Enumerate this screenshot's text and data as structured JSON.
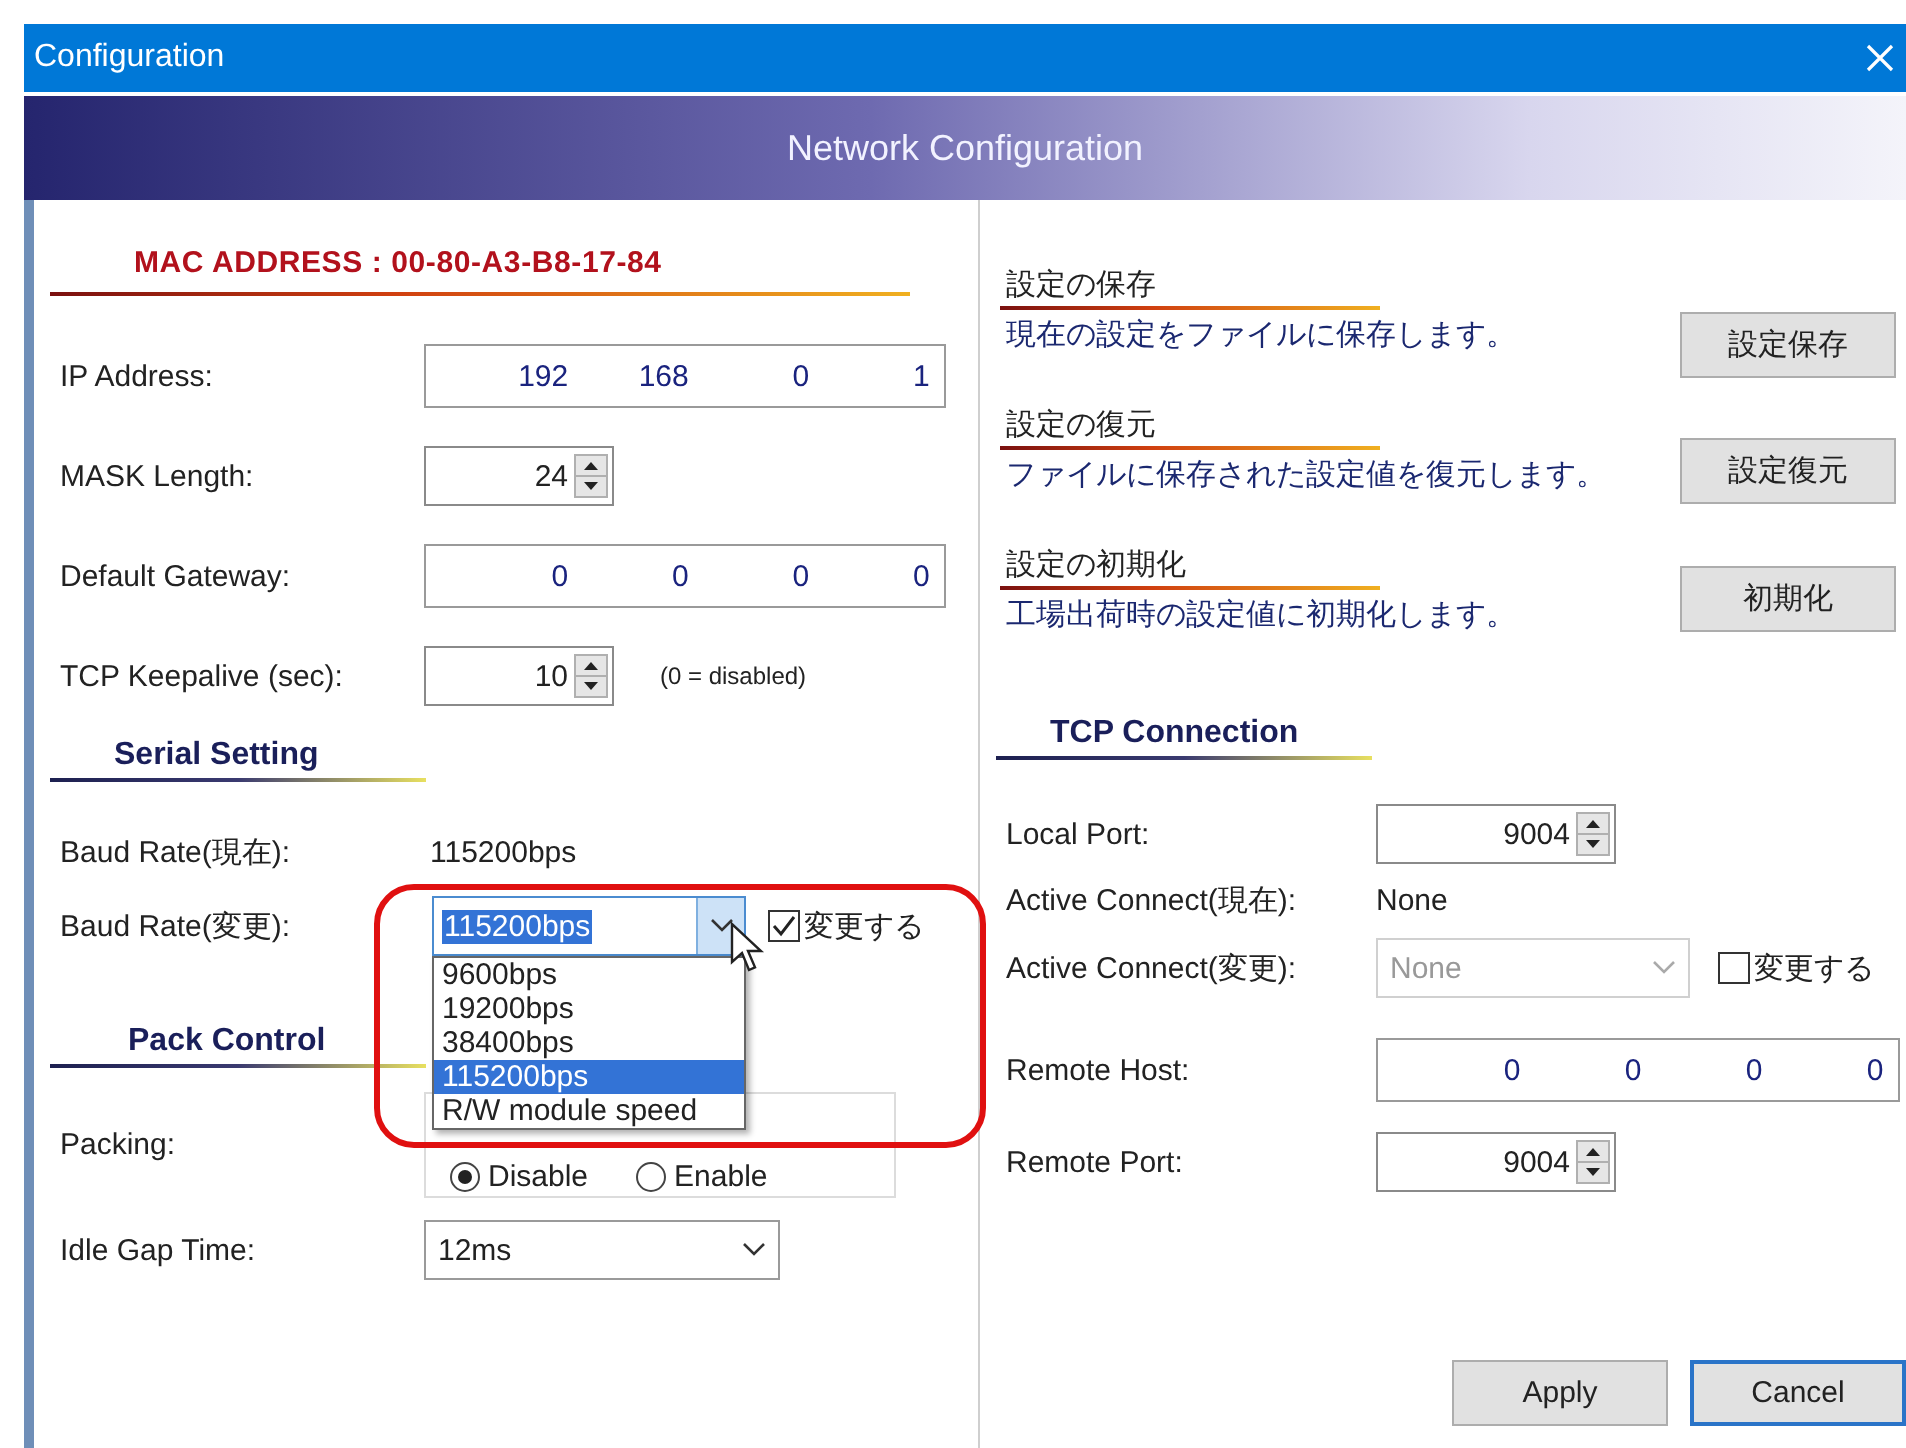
{
  "window": {
    "title": "Configuration"
  },
  "header": {
    "title": "Network Configuration"
  },
  "left": {
    "mac_heading": "MAC ADDRESS : 00-80-A3-B8-17-84",
    "network_fields": [
      {
        "label": "IP Address:",
        "kind": "ip",
        "octets": [
          "192",
          "168",
          "0",
          "1"
        ]
      },
      {
        "label": "MASK Length:",
        "kind": "spin",
        "value": "24"
      },
      {
        "label": "Default Gateway:",
        "kind": "ip",
        "octets": [
          "0",
          "0",
          "0",
          "0"
        ]
      },
      {
        "label": "TCP Keepalive (sec):",
        "kind": "spin",
        "value": "10",
        "note": "(0 = disabled)"
      }
    ],
    "serial": {
      "heading": "Serial Setting",
      "current_label": "Baud Rate(現在):",
      "current_value": "115200bps",
      "change_label": "Baud Rate(変更):",
      "change_value": "115200bps",
      "change_checkbox": {
        "label": "変更する",
        "checked": true
      },
      "dropdown": {
        "options": [
          {
            "label": "9600bps",
            "selected": false
          },
          {
            "label": "19200bps",
            "selected": false
          },
          {
            "label": "38400bps",
            "selected": false
          },
          {
            "label": "115200bps",
            "selected": true
          },
          {
            "label": "R/W module speed",
            "selected": false
          }
        ]
      }
    },
    "pack": {
      "heading": "Pack Control",
      "packing_label": "Packing:",
      "packing_options": [
        {
          "label": "Disable",
          "selected": true
        },
        {
          "label": "Enable",
          "selected": false
        }
      ],
      "idle_label": "Idle Gap Time:",
      "idle_value": "12ms"
    }
  },
  "right": {
    "file_actions": [
      {
        "heading": "設定の保存",
        "description": "現在の設定をファイルに保存します。",
        "button": "設定保存"
      },
      {
        "heading": "設定の復元",
        "description": "ファイルに保存された設定値を復元します。",
        "button": "設定復元"
      },
      {
        "heading": "設定の初期化",
        "description": "工場出荷時の設定値に初期化します。",
        "button": "初期化"
      }
    ],
    "tcp": {
      "heading": "TCP Connection",
      "fields": [
        {
          "label": "Local Port:",
          "kind": "spin",
          "value": "9004"
        },
        {
          "label": "Active Connect(現在):",
          "kind": "text",
          "value": "None"
        },
        {
          "label": "Active Connect(変更):",
          "kind": "combo",
          "value": "None",
          "disabled": true,
          "checkbox": {
            "label": "変更する",
            "checked": false
          }
        },
        {
          "label": "Remote Host:",
          "kind": "ip",
          "octets": [
            "0",
            "0",
            "0",
            "0"
          ]
        },
        {
          "label": "Remote Port:",
          "kind": "spin",
          "value": "9004"
        }
      ]
    }
  },
  "buttons": [
    {
      "label": "Apply",
      "default": false
    },
    {
      "label": "Cancel",
      "default": true
    }
  ]
}
